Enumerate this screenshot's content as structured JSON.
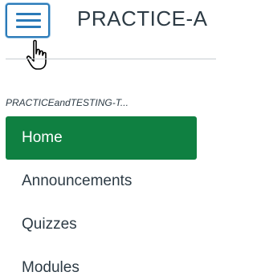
{
  "header": {
    "course_title": "PRACTICE-A",
    "menu_icon": "hamburger-menu-icon",
    "cursor_icon": "hand-pointer-icon",
    "accent_color": "#2a7ab8"
  },
  "sidebar": {
    "course_name": "PRACTICEandTESTING-T...",
    "active_color": "#0f8041",
    "items": [
      {
        "label": "Home",
        "active": true
      },
      {
        "label": "Announcements",
        "active": false
      },
      {
        "label": "Quizzes",
        "active": false
      },
      {
        "label": "Modules",
        "active": false
      }
    ]
  }
}
